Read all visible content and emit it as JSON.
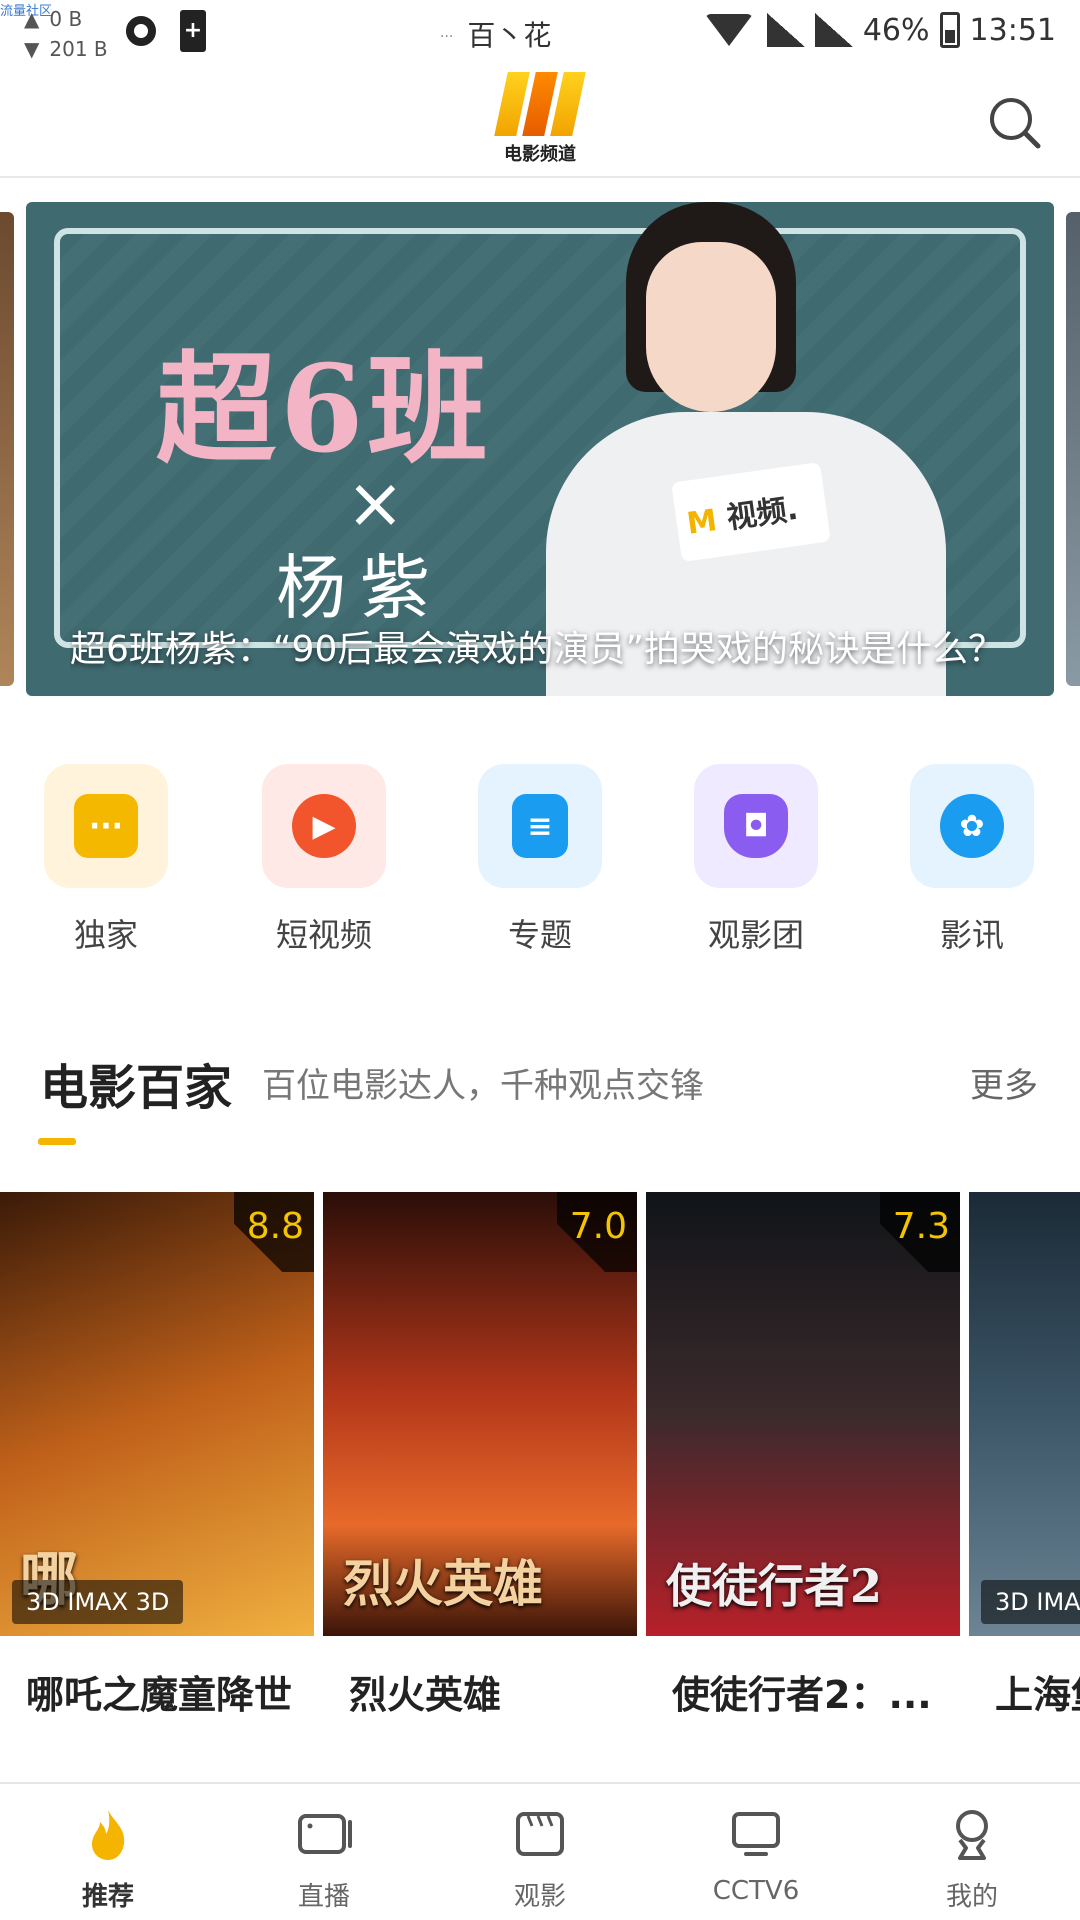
{
  "status_bar": {
    "tiny_label": "流量社区",
    "upload": "0 B",
    "download": "201 B",
    "carrier": "百丶花",
    "battery_pct": "46%",
    "time": "13:51"
  },
  "header": {
    "logo_text": "电影频道"
  },
  "banner": {
    "art_title": "超6班",
    "art_x": "×",
    "art_name": "杨紫",
    "mic_text": "视频.",
    "caption": "超6班杨紫：“90后最会演戏的演员”拍哭戏的秘诀是什么？"
  },
  "categories": [
    {
      "label": "独家",
      "icon": "chat-dots-icon",
      "bg": "#fff3dc",
      "fg": "#f5b800"
    },
    {
      "label": "短视频",
      "icon": "play-circle-icon",
      "bg": "#ffe9e6",
      "fg": "#f2552c"
    },
    {
      "label": "专题",
      "icon": "topic-icon",
      "bg": "#e5f3ff",
      "fg": "#1a9cf0"
    },
    {
      "label": "观影团",
      "icon": "vr-headset-icon",
      "bg": "#efeaff",
      "fg": "#8a5cf0"
    },
    {
      "label": "影讯",
      "icon": "film-reel-icon",
      "bg": "#e5f3ff",
      "fg": "#1a9cf0"
    }
  ],
  "section": {
    "title": "电影百家",
    "subtitle": "百位电影达人，千种观点交锋",
    "more": "更多"
  },
  "movies": [
    {
      "title": "哪吒之魔童降世",
      "rating": "8.8",
      "format": "3D IMAX 3D",
      "overlay": "哪",
      "colors": [
        "#3a1a08",
        "#c0611a",
        "#f0b040"
      ]
    },
    {
      "title": "烈火英雄",
      "rating": "7.0",
      "format": "",
      "overlay": "烈火英雄",
      "colors": [
        "#2a0e08",
        "#b2361a",
        "#e76a2a"
      ]
    },
    {
      "title": "使徒行者2：...",
      "rating": "7.3",
      "format": "",
      "overlay": "使徒行者2",
      "colors": [
        "#101418",
        "#3b2a2c",
        "#b8202a"
      ]
    },
    {
      "title": "上海堡垒",
      "rating": "",
      "format": "3D IMA",
      "overlay": "",
      "colors": [
        "#1b2a36",
        "#3c5668",
        "#6c8494"
      ]
    }
  ],
  "tabs": [
    {
      "label": "推荐",
      "icon": "flame-icon",
      "active": true
    },
    {
      "label": "直播",
      "icon": "tv-live-icon",
      "active": false
    },
    {
      "label": "观影",
      "icon": "clapper-icon",
      "active": false
    },
    {
      "label": "CCTV6",
      "icon": "monitor-icon",
      "active": false
    },
    {
      "label": "我的",
      "icon": "profile-icon",
      "active": false
    }
  ],
  "colors": {
    "accent": "#f5b400",
    "active_tab": "#f5b400",
    "rating": "#f5c400"
  }
}
